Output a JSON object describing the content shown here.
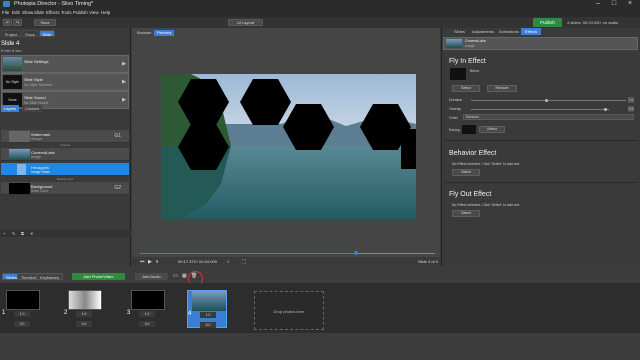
{
  "app": {
    "title": "Photopia Director - Slivo Timing*"
  },
  "menu": [
    "File",
    "Edit",
    "Show",
    "Slide",
    "Effects",
    "Tools",
    "Publish",
    "View",
    "Help"
  ],
  "toolbar": {
    "save": "Save",
    "layout": "UI Layout",
    "publish": "Publish",
    "info": "4 slides, 00:24.000, no audio"
  },
  "left": {
    "tabs": [
      "Project",
      "Show",
      "Slide"
    ],
    "slide_title": "Slide 4",
    "slide_sub": "5 min 8 sec",
    "rows": [
      {
        "icon": "",
        "l1": "Slide Settings",
        "l2": ""
      },
      {
        "icon": "No Style",
        "l1": "Slide Style",
        "l2": "No Style Selected"
      },
      {
        "icon": "None",
        "l1": "Slide Sound",
        "l2": "No Slide Sound"
      }
    ],
    "layer_tabs": [
      "Layers",
      "Content"
    ],
    "layers": [
      {
        "n1": "Watermark",
        "n2": "Always",
        "g": "G1"
      },
      {
        "n1": "CoveredLake",
        "n2": "Image",
        "g": ""
      },
      {
        "n1": "Hexagons",
        "n2": "Image Mask",
        "g": ""
      },
      {
        "n1": "Background",
        "n2": "Solid Color",
        "g": "G2"
      }
    ],
    "seps": [
      "Content",
      "Background"
    ]
  },
  "center": {
    "tabs": [
      "Browser",
      "Preview"
    ],
    "timecode": "00:17.373 / 00:24.000",
    "slide_of": "Slide 4 of 4"
  },
  "right": {
    "tabs": [
      "Slides",
      "Adjustments",
      "Animations",
      "Effects"
    ],
    "object": {
      "n1": "CoveredLake",
      "n2": "Image"
    },
    "fly_in": {
      "title": "Fly In Effect",
      "effect_name": "Blend",
      "select": "Select",
      "remove": "Remove",
      "duration": "Duration",
      "overlap": "Overlap",
      "order": "Order",
      "order_value": "Random",
      "easing": "Easing",
      "easing_btn": "Select",
      "duration_value": "1.0",
      "overlap_value": "0.5"
    },
    "behavior": {
      "title": "Behavior Effect",
      "msg": "No Effect selected. Click 'Select' to add one",
      "select": "Select"
    },
    "fly_out": {
      "title": "Fly Out Effect",
      "msg": "No Effect selected. Click 'Select' to add one",
      "select": "Select"
    }
  },
  "bottom": {
    "tabs": [
      "Slides",
      "Timeline",
      "Keyframes"
    ],
    "add_photo": "Add Photo/Video",
    "add_audio": "Add Audio",
    "slides": [
      {
        "num": "1",
        "dur": "1.0",
        "trans": "3.0"
      },
      {
        "num": "2",
        "dur": "1.0",
        "trans": "4.0"
      },
      {
        "num": "3",
        "dur": "1.0",
        "trans": "3.0"
      },
      {
        "num": "4",
        "dur": "1.0",
        "trans": "8.0"
      }
    ],
    "drop": "Drop photos here"
  }
}
